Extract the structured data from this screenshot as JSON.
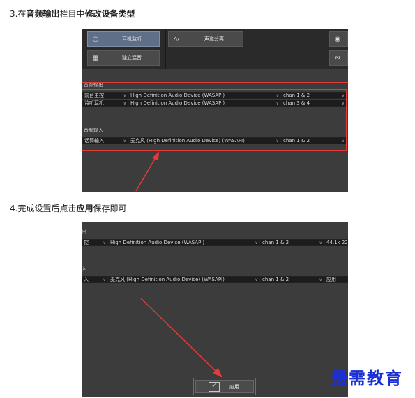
{
  "step3": {
    "prefix": "3.在",
    "bold1": "音频输出",
    "mid": "栏目中",
    "bold2": "修改设备类型"
  },
  "step4": {
    "prefix": "4.完成设置后点击",
    "bold": "应用",
    "suffix": "保存即可"
  },
  "shot1": {
    "buttons": {
      "headphone": "耳机监听",
      "split": "声道分离",
      "solo": "独立混音"
    },
    "output_label": "音频输出",
    "input_label": "音频输入",
    "output_rows": [
      {
        "name": "前台主控",
        "device": "High Definition Audio Device (WASAPI)",
        "chan": "chan 1 & 2"
      },
      {
        "name": "监听耳机",
        "device": "High Definition Audio Device (WASAPI)",
        "chan": "chan 3 & 4"
      }
    ],
    "input_row": {
      "name": "话筒输入",
      "device": "麦克风 (High Definition Audio Device) (WASAPI)",
      "chan": "chan 1 & 2"
    }
  },
  "shot2": {
    "output_label": "出",
    "input_label": "入",
    "output_row": {
      "name": "控",
      "device": "High Definition Audio Device (WASAPI)",
      "chan": "chan 1 & 2",
      "rate": "44.1k 22"
    },
    "input_row": {
      "name": "入",
      "device": "麦克风 (High Definition Audio Device) (WASAPI)",
      "chan": "chan 1 & 2",
      "extra": "应用"
    },
    "apply_label": "应用"
  },
  "watermark": "最需教育",
  "colors": {
    "highlight": "#e43a3a",
    "panel": "#3c3c3c",
    "active_button": "#5e6f87",
    "logo": "#1a2fd6"
  }
}
